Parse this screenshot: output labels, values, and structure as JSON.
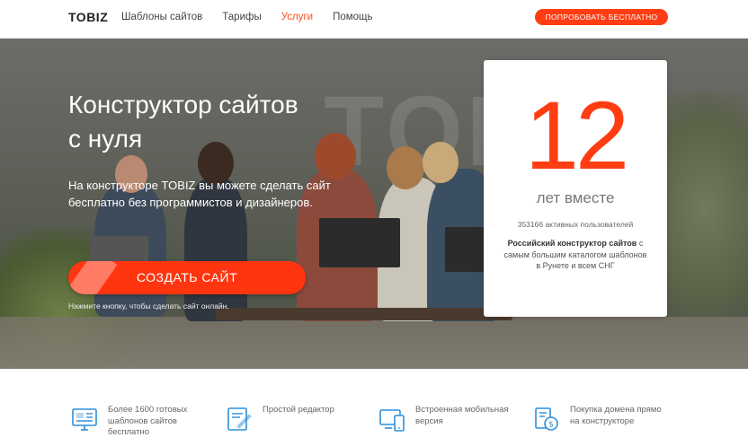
{
  "header": {
    "logo": "TOBIZ",
    "nav": [
      {
        "label": "Шаблоны сайтов",
        "active": false
      },
      {
        "label": "Тарифы",
        "active": false
      },
      {
        "label": "Услуги",
        "active": true
      },
      {
        "label": "Помощь",
        "active": false
      }
    ],
    "try_button": "ПОПРОБОВАТЬ БЕСПЛАТНО"
  },
  "hero": {
    "title_line1": "Конструктор сайтов",
    "title_line2": "с нуля",
    "subtitle_line1": "На конструкторе TOBIZ вы можете сделать сайт",
    "subtitle_line2": "бесплатно без программистов и дизайнеров.",
    "create_button": "СОЗДАТЬ САЙТ",
    "hint": "Нажмите кнопку, чтобы сделать сайт онлайн.",
    "watermark": "TOBIZ"
  },
  "card": {
    "number": "12",
    "years_label": "лет вместе",
    "users": "353166 активных пользователей",
    "desc_bold": "Российский конструктор сайтов",
    "desc_rest": " с самым большим каталогом шаблонов в Рунете и всем СНГ"
  },
  "features": [
    {
      "icon": "templates-monitor-icon",
      "text_lines": [
        "Более 1600 готовых",
        "шаблонов сайтов",
        "бесплатно"
      ]
    },
    {
      "icon": "editor-icon",
      "text_lines": [
        "Простой редактор"
      ]
    },
    {
      "icon": "mobile-version-icon",
      "text_lines": [
        "Встроенная мобильная",
        "версия"
      ]
    },
    {
      "icon": "domain-purchase-icon",
      "text_lines": [
        "Покупка домена прямо",
        "на конструкторе"
      ]
    }
  ],
  "colors": {
    "accent": "#ff3d12",
    "active_nav": "#ff4e1c",
    "icon_blue": "#2f8fd8"
  }
}
